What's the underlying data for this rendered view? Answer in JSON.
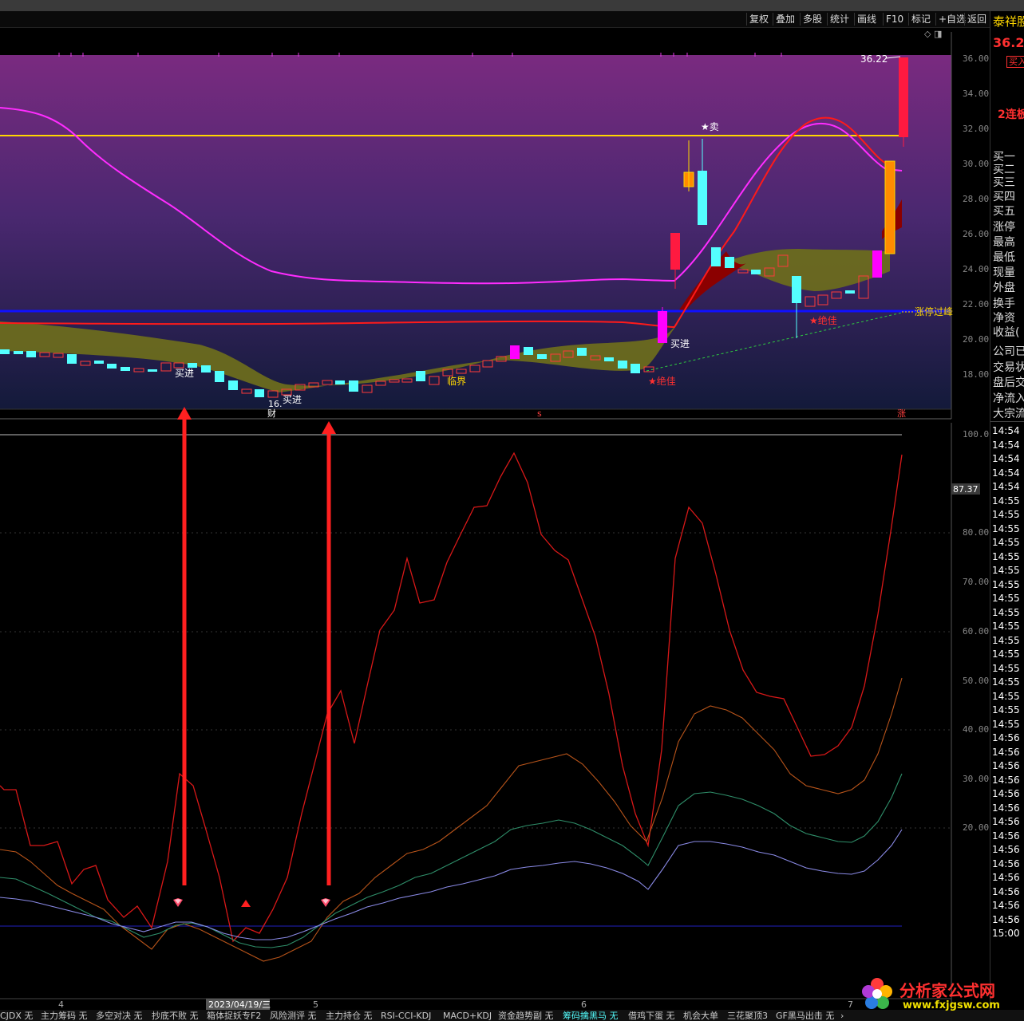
{
  "toolbar": {
    "buttons": [
      "复权",
      "叠加",
      "多股",
      "统计",
      "画线",
      "F10",
      "标记",
      "+自选",
      "返回"
    ]
  },
  "right_panel": {
    "stock_name": "泰祥股",
    "price": "36.2",
    "buy_button": "买入",
    "limit_streak": "2连板",
    "quote_labels": [
      "买一",
      "买二",
      "买三",
      "买四",
      "买五",
      "涨停",
      "最高",
      "最低",
      "现量",
      "外盘",
      "换手",
      "净资",
      "收益(",
      "公司已",
      "交易状",
      "盘后交",
      "净流入",
      "大宗流"
    ],
    "times": [
      "14:54",
      "14:54",
      "14:54",
      "14:54",
      "14:54",
      "14:55",
      "14:55",
      "14:55",
      "14:55",
      "14:55",
      "14:55",
      "14:55",
      "14:55",
      "14:55",
      "14:55",
      "14:55",
      "14:55",
      "14:55",
      "14:55",
      "14:55",
      "14:55",
      "14:55",
      "14:56",
      "14:56",
      "14:56",
      "14:56",
      "14:56",
      "14:56",
      "14:56",
      "14:56",
      "14:56",
      "14:56",
      "14:56",
      "14:56",
      "14:56",
      "14:56",
      "15:00"
    ]
  },
  "price_panel": {
    "y_axis": [
      "36.00",
      "34.00",
      "32.00",
      "30.00",
      "28.00",
      "26.00",
      "24.00",
      "22.00",
      "20.00",
      "18.00"
    ],
    "high_label": "36.22",
    "low_label": "16.",
    "annotations": {
      "sell": "★卖",
      "buy_in_1": "买进",
      "buy_in_2": "买进",
      "buy_in_3": "买进",
      "critical": "临界",
      "best_1": "★绝佳",
      "best_2": "★绝佳",
      "limit_pass": "涨停过峰",
      "cai": "财",
      "s_mark": "s",
      "zhang": "涨"
    }
  },
  "indicator_panel": {
    "y_axis": [
      "100.0",
      "90.00",
      "80.00",
      "70.00",
      "60.00",
      "50.00",
      "40.00",
      "30.00",
      "20.00",
      "10.00"
    ],
    "current_value": "87.37"
  },
  "x_axis": {
    "labels": [
      "4",
      "2023/04/19/三",
      "5",
      "6",
      "7"
    ]
  },
  "tabs": [
    "CJDX 无",
    "主力筹码 无",
    "多空对决 无",
    "抄底不败 无",
    "箱体捉妖专F2",
    "风险测评 无",
    "主力持仓 无",
    "RSI-CCI-KDJ",
    "MACD+KDJ",
    "资金趋势副 无",
    "筹码擒黑马 无",
    "借鸡下蛋 无",
    "机会大单",
    "三花聚顶3",
    "GF黑马出击 无"
  ],
  "watermark": {
    "title": "分析家公式网",
    "url": "www.fxjgsw.com"
  },
  "colors": {
    "red": "#ff2020",
    "cyan": "#54ffff",
    "magenta": "#ff00ff",
    "yellow": "#ffd700",
    "blue": "#1010ff",
    "olive": "#6b6b1e"
  }
}
